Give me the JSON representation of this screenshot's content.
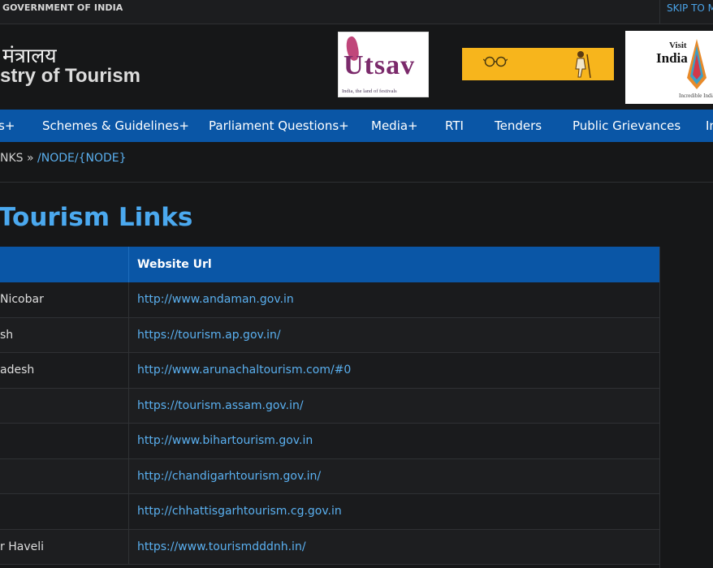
{
  "topbar": {
    "gov_text": "GOVERNMENT OF INDIA",
    "skip_link": "SKIP TO M"
  },
  "header": {
    "title_hindi": "मंत्रालय",
    "title_english": "stry of Tourism",
    "utsav_logo": {
      "word": "Utsav",
      "tagline": "India, the land of festivals"
    },
    "visit_india_logo": {
      "visit": "Visit",
      "india": "India",
      "incredible": "Incredible India"
    }
  },
  "nav": {
    "items": [
      "s+",
      "Schemes & Guidelines+",
      "Parliament Questions+",
      "Media+",
      "RTI",
      "Tenders",
      "Public Grievances",
      "In"
    ]
  },
  "breadcrumb": {
    "prefix": "NKS » ",
    "current": "/NODE/{NODE}"
  },
  "page": {
    "title": "Tourism Links"
  },
  "table": {
    "headers": [
      "",
      "Website Url"
    ],
    "rows": [
      {
        "state": "Nicobar",
        "url": "http://www.andaman.gov.in"
      },
      {
        "state": "sh",
        "url": "https://tourism.ap.gov.in/"
      },
      {
        "state": "adesh",
        "url": "http://www.arunachaltourism.com/#0"
      },
      {
        "state": "",
        "url": "https://tourism.assam.gov.in/"
      },
      {
        "state": "",
        "url": "http://www.bihartourism.gov.in"
      },
      {
        "state": "",
        "url": "http://chandigarhtourism.gov.in/"
      },
      {
        "state": "",
        "url": "http://chhattisgarhtourism.cg.gov.in"
      },
      {
        "state": "r Haveli",
        "url": "https://www.tourismdddnh.in/"
      }
    ]
  },
  "colors": {
    "accent_blue": "#0a56a6",
    "link_blue": "#5ab0f0",
    "title_blue": "#4ba9ef",
    "banner_yellow": "#f7b51c"
  }
}
